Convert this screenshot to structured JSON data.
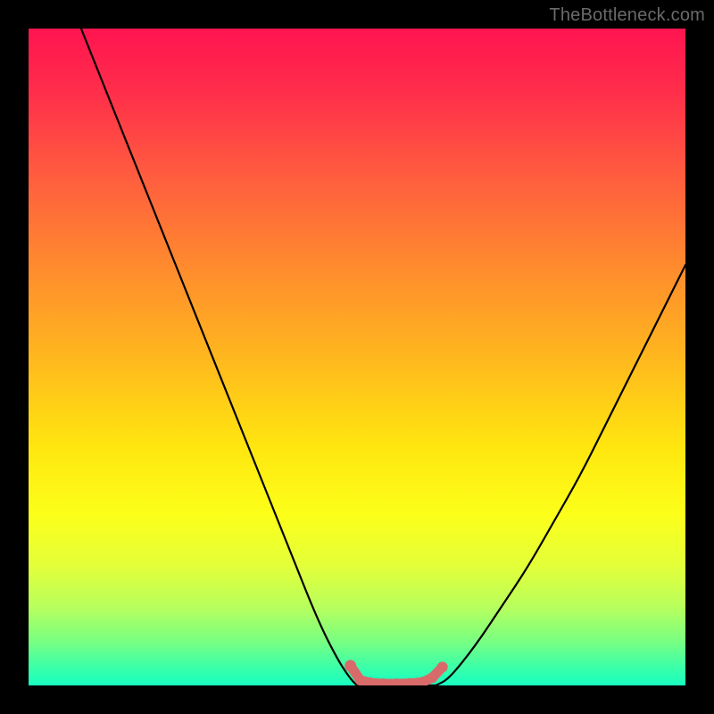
{
  "watermark": "TheBottleneck.com",
  "chart_data": {
    "type": "line",
    "title": "",
    "xlabel": "",
    "ylabel": "",
    "xlim": [
      0,
      100
    ],
    "ylim": [
      0,
      100
    ],
    "series": [
      {
        "name": "left-curve",
        "x": [
          8,
          12,
          16,
          20,
          24,
          28,
          32,
          36,
          40,
          44,
          47,
          49,
          50
        ],
        "y": [
          100,
          90,
          80,
          70,
          60,
          50,
          40,
          30,
          20,
          10,
          4,
          1,
          0
        ]
      },
      {
        "name": "right-curve",
        "x": [
          62,
          64,
          68,
          72,
          76,
          80,
          84,
          88,
          92,
          96,
          100
        ],
        "y": [
          0,
          1,
          6,
          12,
          18,
          25,
          32,
          40,
          48,
          56,
          64
        ]
      }
    ],
    "flat_region": {
      "x_start": 50,
      "x_end": 62,
      "y": 0
    },
    "marker_points": [
      {
        "x": 49,
        "y": 3.0
      },
      {
        "x": 50.5,
        "y": 0.8
      },
      {
        "x": 52,
        "y": 0.4
      },
      {
        "x": 54,
        "y": 0.25
      },
      {
        "x": 56,
        "y": 0.25
      },
      {
        "x": 58,
        "y": 0.3
      },
      {
        "x": 60,
        "y": 0.5
      },
      {
        "x": 61.5,
        "y": 1.2
      },
      {
        "x": 63,
        "y": 2.8
      }
    ],
    "colors": {
      "curve": "#000000",
      "markers": "#d86a6a",
      "frame": "#000000"
    }
  }
}
